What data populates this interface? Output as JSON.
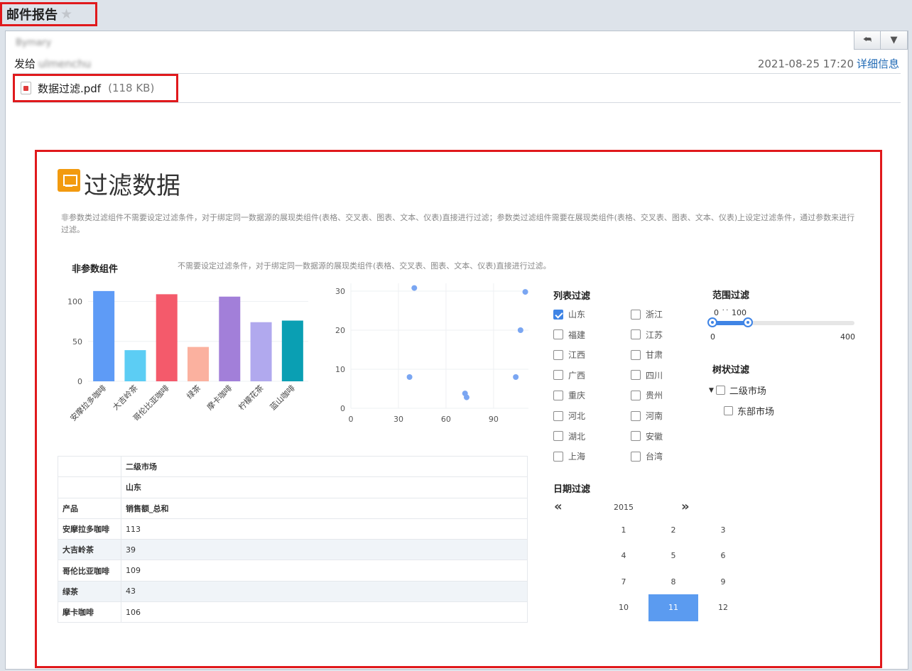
{
  "app": {
    "title": "邮件报告",
    "star_icon": "star-icon"
  },
  "email": {
    "sender": "Bymary",
    "to_label": "发给",
    "to_name": "ulmenchu",
    "datetime": "2021-08-25 17:20",
    "detail_link": "详细信息",
    "attachment": {
      "name": "数据过滤.pdf",
      "size": "(118 KB)"
    }
  },
  "report": {
    "title": "过滤数据",
    "description": "非参数类过滤组件不需要设定过滤条件，对于绑定同一数据源的展现类组件(表格、交叉表、图表、文本、仪表)直接进行过滤；参数类过滤组件需要在展现类组件(表格、交叉表、图表、文本、仪表)上设定过滤条件，通过参数来进行过滤。",
    "nonparam_title": "非参数组件",
    "nonparam_desc": "不需要设定过滤条件，对于绑定同一数据源的展现类组件(表格、交叉表、图表、文本、仪表)直接进行过滤。",
    "list_filter_title": "列表过滤",
    "range_filter_title": "范围过滤",
    "tree_filter_title": "树状过滤",
    "date_filter_title": "日期过滤"
  },
  "chart_data": [
    {
      "type": "bar",
      "categories": [
        "安摩拉多咖啡",
        "大吉岭茶",
        "哥伦比亚咖啡",
        "绿茶",
        "摩卡咖啡",
        "柠檬花茶",
        "蓝山咖啡"
      ],
      "values": [
        113,
        39,
        109,
        43,
        106,
        74,
        76
      ],
      "colors": [
        "#5e9bf6",
        "#5ccdf4",
        "#f45a6b",
        "#fbb19f",
        "#a27fd9",
        "#b1a9ee",
        "#0a9fb3"
      ],
      "yticks": [
        0,
        50,
        100
      ],
      "ylim": [
        0,
        120
      ]
    },
    {
      "type": "scatter",
      "points": [
        [
          40,
          30.8
        ],
        [
          110,
          29.8
        ],
        [
          107,
          20
        ],
        [
          37,
          8
        ],
        [
          72,
          3.8
        ],
        [
          73,
          2.8
        ],
        [
          104,
          8
        ]
      ],
      "color": "#7aa6f2",
      "xticks": [
        0,
        30,
        60,
        90
      ],
      "yticks": [
        0,
        10,
        20,
        30
      ],
      "xlim": [
        0,
        112
      ],
      "ylim": [
        0,
        32
      ]
    }
  ],
  "list_filter": {
    "items": [
      {
        "label": "山东",
        "checked": true
      },
      {
        "label": "浙江",
        "checked": false
      },
      {
        "label": "福建",
        "checked": false
      },
      {
        "label": "江苏",
        "checked": false
      },
      {
        "label": "江西",
        "checked": false
      },
      {
        "label": "甘肃",
        "checked": false
      },
      {
        "label": "广西",
        "checked": false
      },
      {
        "label": "四川",
        "checked": false
      },
      {
        "label": "重庆",
        "checked": false
      },
      {
        "label": "贵州",
        "checked": false
      },
      {
        "label": "河北",
        "checked": false
      },
      {
        "label": "河南",
        "checked": false
      },
      {
        "label": "湖北",
        "checked": false
      },
      {
        "label": "安徽",
        "checked": false
      },
      {
        "label": "上海",
        "checked": false
      },
      {
        "label": "台湾",
        "checked": false
      }
    ]
  },
  "range_filter": {
    "value_low": "0",
    "value_high": "100",
    "min": "0",
    "max": "400",
    "low": 0,
    "high": 100,
    "max_value": 400
  },
  "tree_filter": {
    "root": "二级市场",
    "child": "东部市场"
  },
  "date_filter": {
    "prev": "«",
    "next": "»",
    "year": "2015",
    "months": [
      "1",
      "2",
      "3",
      "4",
      "5",
      "6",
      "7",
      "8",
      "9",
      "10",
      "11",
      "12"
    ],
    "selected_index": 10
  },
  "table": {
    "header1": "二级市场",
    "header2": "山东",
    "col_product": "产品",
    "col_sales": "销售额_总和",
    "rows": [
      {
        "product": "安摩拉多咖啡",
        "value": "113"
      },
      {
        "product": "大吉岭茶",
        "value": "39"
      },
      {
        "product": "哥伦比亚咖啡",
        "value": "109"
      },
      {
        "product": "绿茶",
        "value": "43"
      },
      {
        "product": "摩卡咖啡",
        "value": "106"
      }
    ]
  }
}
